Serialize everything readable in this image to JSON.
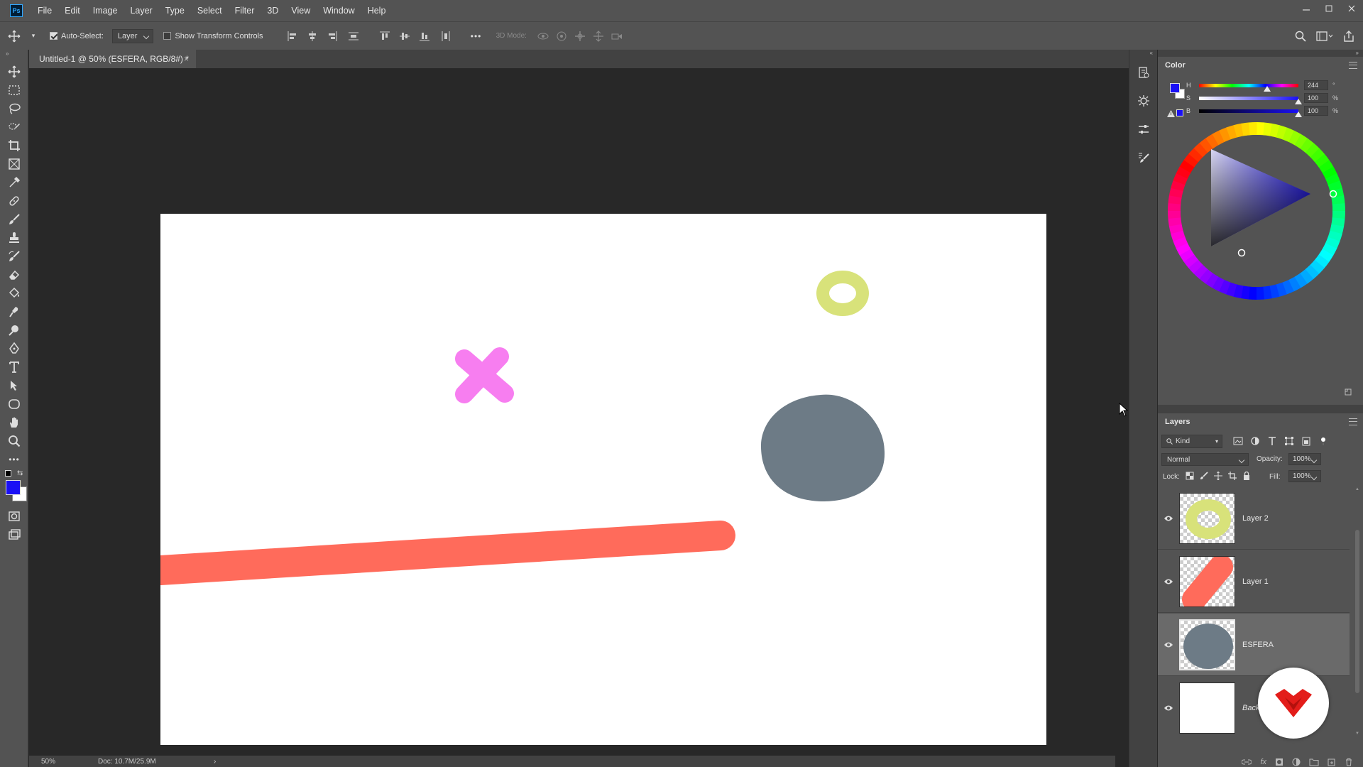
{
  "app": {
    "logo_text": "Ps",
    "menu": [
      "File",
      "Edit",
      "Image",
      "Layer",
      "Type",
      "Select",
      "Filter",
      "3D",
      "View",
      "Window",
      "Help"
    ]
  },
  "options_bar": {
    "auto_select_label": "Auto-Select:",
    "auto_select_checked": true,
    "auto_select_target": "Layer",
    "show_transform_label": "Show Transform Controls",
    "show_transform_checked": false,
    "mode_3d_label": "3D Mode:",
    "more_label": "•••"
  },
  "document": {
    "tab_title": "Untitled-1 @ 50% (ESFERA, RGB/8#) *",
    "close_glyph": "×",
    "zoom": "50%",
    "doc_info": "Doc: 10.7M/25.9M",
    "status_arrow": "›"
  },
  "toolbar": {
    "more_label": "•••",
    "foreground_color": "#1a10f5",
    "background_color": "#ffffff"
  },
  "color_panel": {
    "tab_label": "Color",
    "h_label": "H",
    "h_value": "244",
    "h_unit": "°",
    "s_label": "S",
    "s_value": "100",
    "s_unit": "%",
    "b_label": "B",
    "b_value": "100",
    "b_unit": "%",
    "foreground_color": "#1a10f5",
    "background_color": "#ffffff"
  },
  "layers_panel": {
    "tab_label": "Layers",
    "filter_label": "Kind",
    "blend_mode": "Normal",
    "opacity_label": "Opacity:",
    "opacity_value": "100%",
    "lock_label": "Lock:",
    "fill_label": "Fill:",
    "fill_value": "100%",
    "layers": [
      {
        "name": "Layer 2",
        "visible": true,
        "selected": false,
        "color": "#d8e27a"
      },
      {
        "name": "Layer 1",
        "visible": true,
        "selected": false,
        "color": "#ff6b5b"
      },
      {
        "name": "ESFERA",
        "visible": true,
        "selected": true,
        "color": "#6d7b86"
      },
      {
        "name": "Back",
        "visible": true,
        "selected": false,
        "color": "#ffffff"
      }
    ]
  },
  "canvas_shapes": {
    "cross_color": "#f77ef0",
    "ring_color": "#d8e27a",
    "sphere_color": "#6d7b86",
    "capsule_color": "#ff6b5b"
  }
}
